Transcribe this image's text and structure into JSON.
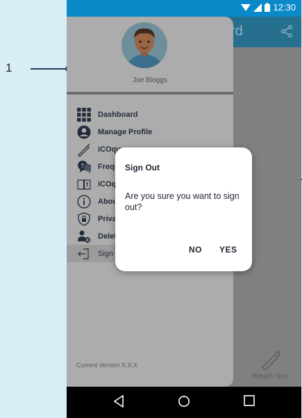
{
  "callouts": {
    "left_label": "1"
  },
  "status_bar": {
    "time": "12:30"
  },
  "app_bar": {
    "title_fragment": "rd"
  },
  "drawer": {
    "user_name": "Joe Bloggs",
    "items": [
      {
        "label": "Dashboard",
        "icon": "grid-icon"
      },
      {
        "label": "Manage Profile",
        "icon": "profile-icon"
      },
      {
        "label": "iCOqu",
        "icon": "pencil-icon"
      },
      {
        "label": "Frequ",
        "icon": "faq-icon"
      },
      {
        "label": "iCOq",
        "icon": "book-icon"
      },
      {
        "label": "Abou",
        "icon": "info-icon"
      },
      {
        "label": "Priva",
        "icon": "shield-icon"
      },
      {
        "label": "Delet",
        "icon": "delete-user-icon"
      },
      {
        "label": "Sign Out",
        "icon": "logout-icon",
        "selected": true
      }
    ],
    "version": "Current Version X.X.X"
  },
  "background": {
    "breath_test_label": "Breath Test"
  },
  "dialog": {
    "title": "Sign Out",
    "message": "Are you sure you want to sign out?",
    "no_label": "NO",
    "yes_label": "YES"
  },
  "colors": {
    "status_bar": "#0a89c8",
    "app_bar": "#266f8e",
    "callout": "#1d3a5a",
    "page_background": "#d9edf7"
  }
}
